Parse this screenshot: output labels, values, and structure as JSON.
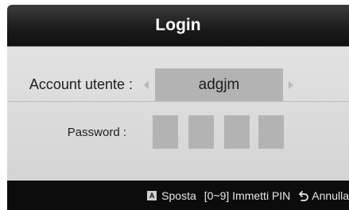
{
  "dialog": {
    "title": "Login"
  },
  "account": {
    "label": "Account utente :",
    "value": "adgjm"
  },
  "password": {
    "label": "Password :",
    "pin_slots": 4
  },
  "footer": {
    "move_key": "A",
    "move_label": "Sposta",
    "pin_label": "[0~9] Immetti PIN",
    "cancel_label": "Annulla"
  },
  "icons": {
    "left_arrow": "chevron-left-icon",
    "right_arrow": "chevron-right-icon",
    "return": "return-icon"
  }
}
